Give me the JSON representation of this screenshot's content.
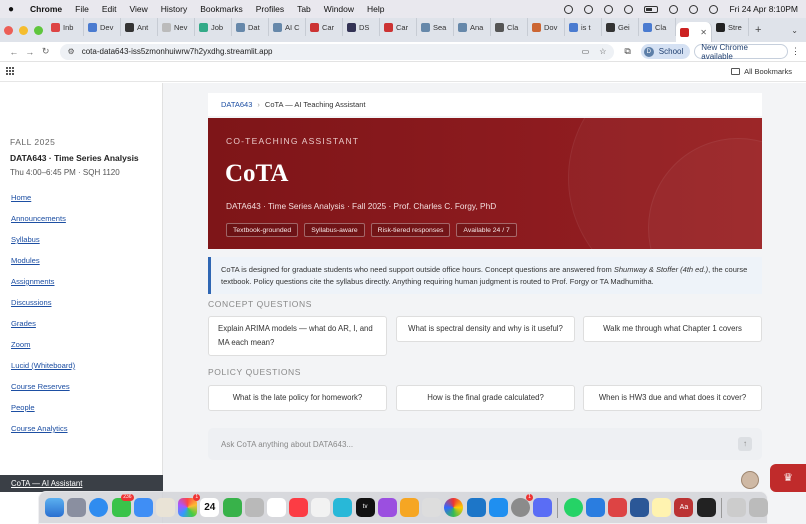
{
  "menubar": {
    "app": "Chrome",
    "items": [
      "File",
      "Edit",
      "View",
      "History",
      "Bookmarks",
      "Profiles",
      "Tab",
      "Window",
      "Help"
    ],
    "clock": "Fri 24 Apr  8:10PM"
  },
  "tabs": [
    {
      "label": "Inb",
      "color": "#d44"
    },
    {
      "label": "Dev",
      "color": "#4a7bd0"
    },
    {
      "label": "Ant",
      "color": "#333"
    },
    {
      "label": "Nev",
      "color": "#bbb"
    },
    {
      "label": "Job",
      "color": "#3a8"
    },
    {
      "label": "Dat",
      "color": "#68a"
    },
    {
      "label": "AI C",
      "color": "#68a"
    },
    {
      "label": "Car",
      "color": "#c33"
    },
    {
      "label": "DS",
      "color": "#335"
    },
    {
      "label": "Car",
      "color": "#c33"
    },
    {
      "label": "Sea",
      "color": "#68a"
    },
    {
      "label": "Ana",
      "color": "#68a"
    },
    {
      "label": "Cla",
      "color": "#555"
    },
    {
      "label": "Dov",
      "color": "#c63"
    },
    {
      "label": "is t",
      "color": "#4a7bd0"
    },
    {
      "label": "Gei",
      "color": "#333"
    },
    {
      "label": "Cla",
      "color": "#4a7bd0"
    },
    {
      "label": "",
      "color": "#c22",
      "active": true
    },
    {
      "label": "Stre",
      "color": "#222"
    }
  ],
  "address": {
    "url": "cota-data643-iss5zmonhuiwrw7h2yxdhg.streamlit.app",
    "profile": "School",
    "profile_initial": "D",
    "update": "New Chrome available"
  },
  "bookmarks": {
    "all": "All Bookmarks"
  },
  "sidebar": {
    "term": "FALL 2025",
    "course": "DATA643 · Time Series Analysis",
    "schedule": "Thu 4:00–6:45 PM  ·  SQH 1120",
    "nav": [
      "Home",
      "Announcements",
      "Syllabus",
      "Modules",
      "Assignments",
      "Discussions",
      "Grades",
      "Zoom",
      "Lucid (Whiteboard)",
      "Course Reserves",
      "People",
      "Course Analytics"
    ],
    "active": "CoTA — AI Assistant"
  },
  "breadcrumb": {
    "course": "DATA643",
    "current": "CoTA — AI Teaching Assistant"
  },
  "hero": {
    "eyebrow": "CO-TEACHING ASSISTANT",
    "title": "CoTA",
    "meta": "DATA643 · Time Series Analysis  ·  Fall 2025  ·  Prof. Charles C. Forgy, PhD",
    "badges": [
      "Textbook-grounded",
      "Syllabus-aware",
      "Risk-tiered responses",
      "Available 24 / 7"
    ]
  },
  "info": {
    "pre": "CoTA is designed for graduate students who need support outside office hours. Concept questions are answered from ",
    "book": "Shumway & Stoffer (4th ed.)",
    "post": ", the course textbook. Policy questions cite the syllabus directly. Anything requiring human judgment is routed to Prof. Forgy or TA Madhumitha."
  },
  "concept": {
    "heading": "CONCEPT QUESTIONS",
    "questions": [
      "Explain ARIMA models — what do AR, I, and MA each mean?",
      "What is spectral density and why is it useful?",
      "Walk me through what Chapter 1 covers"
    ]
  },
  "policy": {
    "heading": "POLICY QUESTIONS",
    "questions": [
      "What is the late policy for homework?",
      "How is the final grade calculated?",
      "When is HW3 due and what does it cover?"
    ]
  },
  "chat": {
    "placeholder": "Ask CoTA anything about DATA643..."
  },
  "dock": {
    "calendar_day": "24",
    "badges": {
      "messages": "236",
      "photos": "1",
      "settings": "1"
    }
  }
}
